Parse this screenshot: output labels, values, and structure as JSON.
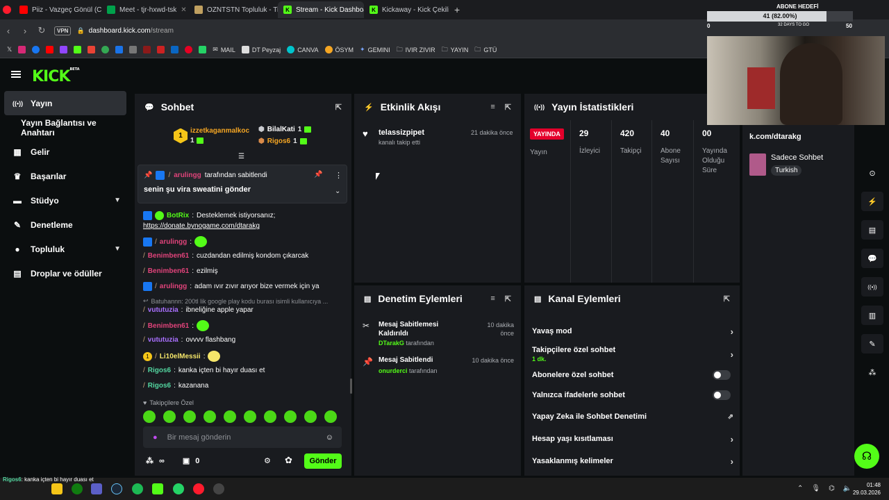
{
  "browser": {
    "tabs": [
      {
        "label": "Piiz - Vazgeç Gönül (C",
        "color": "#ff0000"
      },
      {
        "label": "Meet - tjr-hxwd-tsk",
        "color": "#00a14b"
      },
      {
        "label": "OZNTSTN Topluluk - Tier I",
        "color": "#c0a060"
      },
      {
        "label": "Stream - Kick Dashboard",
        "color": "#53fc18"
      },
      {
        "label": "Kickaway - Kick Çekiliş Ara",
        "color": "#53fc18"
      }
    ],
    "vpn": "VPN",
    "url_host": "dashboard.kick.com",
    "url_path": "/stream",
    "bookmarks": [
      "MAIL",
      "DT Peyzaj",
      "CANVA",
      "ÖSYM",
      "GEMINI",
      "IVIR ZIVIR",
      "YAYIN",
      "GTÜ"
    ]
  },
  "overlay": {
    "title": "ABONE HEDEFİ",
    "progress": "41 (82.00%)",
    "progress_value": 0.82,
    "left_num": "0",
    "right_num": "50",
    "days": "32 DAYS TO GO"
  },
  "sidebar": {
    "items": [
      {
        "label": "Yayın",
        "icon": "((•))"
      },
      {
        "label": "Yayın Bağlantısı ve Anahtarı",
        "icon": ""
      },
      {
        "label": "Gelir",
        "icon": "▮"
      },
      {
        "label": "Başarılar",
        "icon": "🏆"
      },
      {
        "label": "Stüdyo",
        "icon": "◼"
      },
      {
        "label": "Denetleme",
        "icon": "🔧"
      },
      {
        "label": "Topluluk",
        "icon": "●"
      },
      {
        "label": "Droplar ve ödüller",
        "icon": "▤"
      }
    ]
  },
  "chat": {
    "title": "Sohbet",
    "leaders": [
      {
        "name": "izzetkaganmalkoc",
        "count": "1"
      },
      {
        "name": "BilalKati",
        "count": "1"
      },
      {
        "name": "Rigos6",
        "count": "1"
      }
    ],
    "pinned_by": "arulingg",
    "pinned_suffix": "tarafından sabitlendi",
    "pinned_text": "senin şu vira sweatini gönder",
    "messages": [
      {
        "user": "BotRix",
        "text": "Desteklemek istiyorsanız;",
        "color": "#53fc18"
      },
      {
        "user": "",
        "text": "https://donate.bynogame.com/dtarakg",
        "color": "#fff"
      },
      {
        "user": "arulingg",
        "text": "",
        "color": "#e0437a"
      },
      {
        "user": "Benimben61",
        "text": "cuzdandan edilmiş kondom çıkarcak",
        "color": "#e0437a"
      },
      {
        "user": "Benimben61",
        "text": "ezilmiş",
        "color": "#e0437a"
      },
      {
        "user": "arulingg",
        "text": "adam ıvır zıvır arıyor bize vermek için ya",
        "color": "#e0437a"
      },
      {
        "user": "",
        "text": "Batuhannn: 200tl lik google play kodu burası isimli kullanıcıya ...",
        "color": "#8e9196"
      },
      {
        "user": "vututuzia",
        "text": "ibneliğine apple yapar",
        "color": "#a970ff"
      },
      {
        "user": "Benimben61",
        "text": "",
        "color": "#e0437a"
      },
      {
        "user": "vututuzia",
        "text": "ovvvv flashbang",
        "color": "#a970ff"
      },
      {
        "user": "Li10elMessii",
        "text": "",
        "color": "#f5e66a"
      },
      {
        "user": "Rigos6",
        "text": "kanka içten bi hayır duası et",
        "color": "#53d6a0"
      },
      {
        "user": "Rigos6",
        "text": "kazanana",
        "color": "#53d6a0"
      }
    ],
    "followers_only": "Takipçilere Özel",
    "placeholder": "Bir mesaj gönderin",
    "points": "0",
    "send": "Gönder"
  },
  "activity": {
    "title": "Etkinlik Akışı",
    "items": [
      {
        "user": "telassizpipet",
        "action": "kanalı takip etti",
        "time": "21 dakika önce"
      }
    ]
  },
  "stats": {
    "title": "Yayın İstatistikleri",
    "live": "YAYINDA",
    "cols": [
      {
        "value": "",
        "label": "Yayın"
      },
      {
        "value": "29",
        "label": "İzleyici"
      },
      {
        "value": "420",
        "label": "Takipçi"
      },
      {
        "value": "40",
        "label": "Abone Sayısı"
      },
      {
        "value": "00",
        "label": "Yayında Olduğu Süre"
      }
    ]
  },
  "moderation": {
    "title": "Denetim Eylemleri",
    "items": [
      {
        "title": "Mesaj Sabitlemesi Kaldırıldı",
        "by": "DTarakG",
        "suffix": "tarafından",
        "time": "10 dakika önce"
      },
      {
        "title": "Mesaj Sabitlendi",
        "by": "onurderci",
        "suffix": "tarafından",
        "time": "10 dakika önce"
      }
    ]
  },
  "channel": {
    "title": "Kanal Eylemleri",
    "items": [
      {
        "label": "Yavaş mod",
        "sub": ""
      },
      {
        "label": "Takipçilere özel sohbet",
        "sub": "1 dk."
      },
      {
        "label": "Abonelere özel sohbet",
        "sub": ""
      },
      {
        "label": "Yalnızca ifadelerle sohbet",
        "sub": ""
      },
      {
        "label": "Yapay Zeka ile Sohbet Denetimi",
        "sub": ""
      },
      {
        "label": "Hesap yaşı kısıtlaması",
        "sub": ""
      },
      {
        "label": "Yasaklanmış kelimeler",
        "sub": ""
      }
    ]
  },
  "info": {
    "url_part": "k.com/dtarakg",
    "mode": "Sadece Sohbet",
    "lang": "Turkish"
  },
  "taskbar": {
    "time": "01:48",
    "date": "29.03.2026"
  },
  "ticker": {
    "user": "Rigos6",
    "text": "kanka içten bi hayır duası et",
    "line2": "kazanana"
  }
}
